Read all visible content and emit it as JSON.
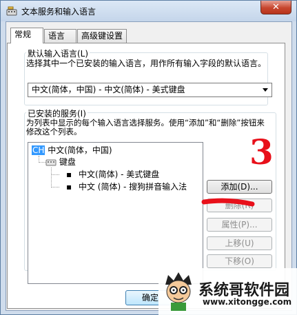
{
  "window": {
    "title": "文本服务和输入语言",
    "close_glyph": "✕"
  },
  "tabs": [
    {
      "label": "常规",
      "active": true
    },
    {
      "label": "语言栏",
      "active": false
    },
    {
      "label": "高级键设置",
      "active": false
    }
  ],
  "default_language": {
    "label": "默认输入语言(L)",
    "description": "选择其中一个已安装的输入语言，用作所有输入字段的默认语言。",
    "selected": "中文(简体，中国) - 中文(简体) - 美式键盘"
  },
  "installed_services": {
    "label": "已安装的服务(I)",
    "description": "为列表中显示的每个输入语言选择服务。使用“添加”和“删除”按钮来修改这个列表。",
    "tree": {
      "language_badge": "CH",
      "language": "中文(简体，中国)",
      "category": "键盘",
      "items": [
        "中文(简体) - 美式键盘",
        "中文 (简体) - 搜狗拼音输入法"
      ]
    }
  },
  "buttons": {
    "add": "添加(D)...",
    "remove": "删除(R)",
    "properties": "属性(P)...",
    "move_up": "上移(U)",
    "move_down": "下移(O)",
    "ok": "确定"
  },
  "annotation": {
    "number": "3",
    "color": "#e8101a"
  },
  "watermark": {
    "name": "系统哥软件园",
    "url": "www.xitongge.com"
  }
}
